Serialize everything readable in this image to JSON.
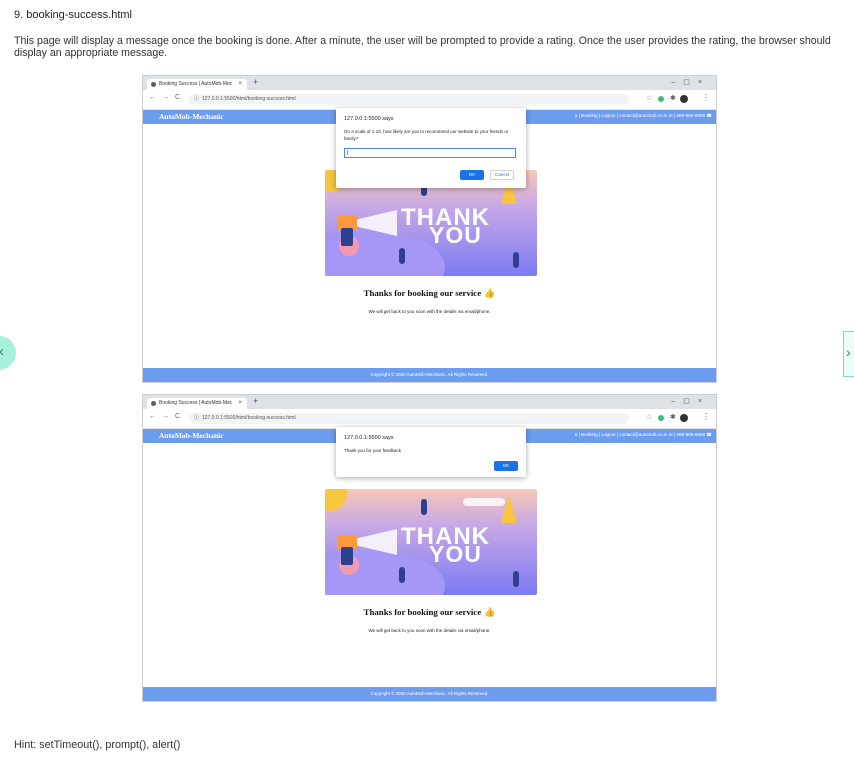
{
  "doc": {
    "heading": "9. booking-success.html",
    "description": "This page will display a message once the booking is done. After a minute, the user will be prompted to provide a rating. Once the user provides the rating, the browser should display an appropriate message.",
    "hint": "Hint: setTimeout(), prompt(), alert()"
  },
  "carousel": {
    "prev_icon": "‹",
    "next_icon": "›"
  },
  "browser": {
    "tab_title": "Booking Success | AutoMob-Mec",
    "tab_close": "×",
    "new_tab": "+",
    "window_controls": "–▢×",
    "back_icon": "←",
    "forward_icon": "→",
    "reload_icon": "C",
    "info_icon": "ⓘ",
    "url": "127.0.0.1:5500/html/booking-success.html",
    "star_icon": "☆",
    "puzzle_icon": "✱",
    "menu_icon": "⋮"
  },
  "site": {
    "brand": "AutoMob-Mechanic",
    "nav_links": "s | Booking | Logout | contact@automob.co.in ✉ | 999-999-9999 ☎",
    "hero_thank": "THANK",
    "hero_you": "YOU",
    "headline": "Thanks for booking our service",
    "thumbs_icon": "👍",
    "subtext": "We will get back to you soon with the details via email/phone.",
    "footer": "Copyright © 2020 AutoMob-Mechanic.  All Rights Reserved."
  },
  "prompt_dialog": {
    "title": "127.0.0.1:5500 says",
    "message": "On a scale of 1-10, how likely are you to recommend our website to your friends or family?",
    "input_value": "|",
    "ok_label": "OK",
    "cancel_label": "Cancel"
  },
  "alert_dialog": {
    "title": "127.0.0.1:5500 says",
    "message": "Thank you for your feedback",
    "ok_label": "OK"
  },
  "colors": {
    "accent_blue": "#6c9ced",
    "button_blue": "#1a73e8",
    "carousel_mint": "#a6f0dd"
  }
}
